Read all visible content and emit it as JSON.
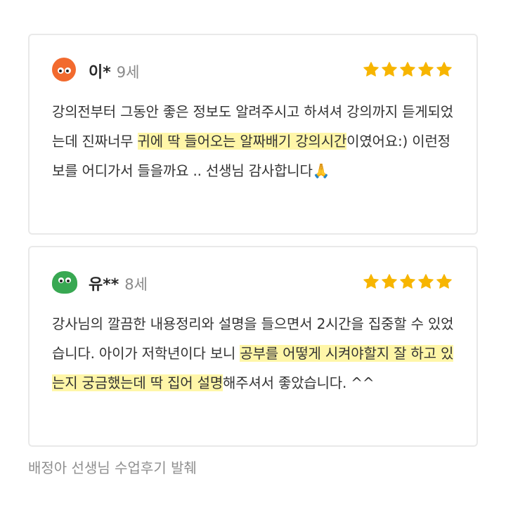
{
  "reviews": [
    {
      "avatar_color": "#f26a2e",
      "avatar_shape": "circle",
      "name": "이*",
      "age": "9세",
      "rating": 5,
      "text_before": "강의전부터 그동안 좋은 정보도 알려주시고 하셔셔 강의까지 듣게되었는데 진짜너무 ",
      "highlight": "귀에 딱 들어오는 알짜배기 강의시간",
      "text_after": "이였어요:) 이런정보를 어디가서 들을까요 .. 선생님 감사합니다🙏"
    },
    {
      "avatar_color": "#38a852",
      "avatar_shape": "blob",
      "name": "유**",
      "age": "8세",
      "rating": 5,
      "text_before": "강사님의 깔끔한 내용정리와 설명을 들으면서 2시간을 집중할 수 있었습니다. 아이가 저학년이다 보니 ",
      "highlight": "공부를 어떻게 시켜야할지 잘 하고 있는지 궁금했는데 딱 집어 설명",
      "text_after": "해주셔서 좋았습니다. ^^"
    }
  ],
  "star_color": "#f7b500",
  "caption": "배정아 선생님 수업후기 발췌"
}
